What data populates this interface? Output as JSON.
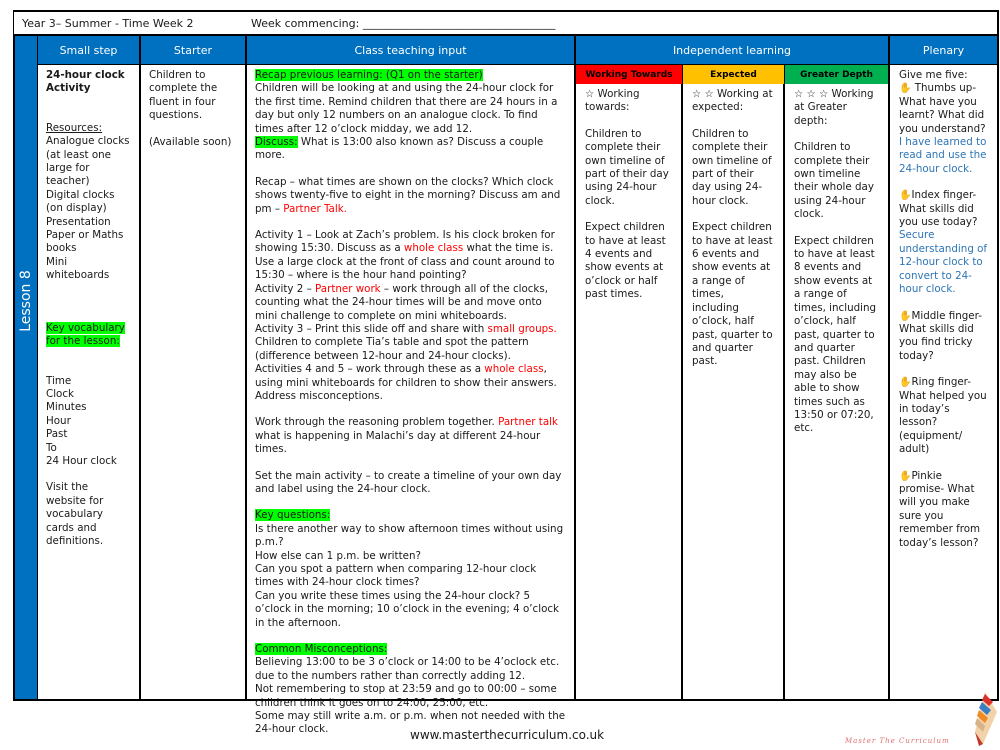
{
  "header": {
    "title": "Year 3– Summer - Time Week 2",
    "week_commencing": "Week commencing: ___________________________________"
  },
  "lesson_label": "Lesson 8",
  "columns": {
    "small_step": "Small step",
    "starter": "Starter",
    "class_teaching": "Class teaching input",
    "independent": "Independent learning",
    "plenary": "Plenary"
  },
  "levels": {
    "working_towards": {
      "label": "Working Towards",
      "color": "#ff0000"
    },
    "expected": {
      "label": "Expected",
      "color": "#ffc000"
    },
    "greater_depth": {
      "label": "Greater Depth",
      "color": "#00b050"
    }
  },
  "colors": {
    "brand_blue": "#0070c0",
    "highlight": "#00ff00",
    "emphasis_red": "#ff0000",
    "answer_blue": "#2e75b6"
  },
  "small_step": {
    "title": "24-hour clock Activity",
    "resources_heading": "Resources:",
    "resources": [
      "Analogue clocks (at least one large for teacher)",
      "Digital clocks (on display)",
      "Presentation",
      "Paper or Maths books",
      "Mini whiteboards"
    ],
    "vocab_heading": "Key vocabulary for the lesson:",
    "vocab": [
      "Time",
      "Clock",
      "Minutes",
      "Hour",
      "Past",
      "To",
      "24 Hour clock"
    ],
    "website_note": "Visit the website for vocabulary cards and definitions."
  },
  "starter": {
    "text": "Children to complete the fluent in four questions.",
    "availability": "(Available soon)"
  },
  "teaching": {
    "recap_heading": "Recap previous learning: (Q1 on the starter)",
    "recap_text": "Children will be looking at and using the 24-hour clock for the first time. Remind children that there are 24 hours in a day but only 12 numbers on an analogue clock. To find times after 12 o’clock midday, we add 12.",
    "discuss_label": "Discuss:",
    "discuss_text": " What is 13:00 also known as? Discuss a couple more.",
    "recap2_text": "Recap – what times are shown on the clocks? Which clock shows twenty-five to eight in the morning? Discuss am and pm – ",
    "recap2_red": "Partner Talk.",
    "a1_pre": "Activity 1 – Look at Zach’s problem. Is his clock broken for showing 15:30. Discuss as a ",
    "a1_red": "whole class",
    "a1_post": " what the time is. Use a large clock at the front of class and count around to 15:30 – where is the hour hand pointing?",
    "a2_pre": "Activity 2 – ",
    "a2_red": "Partner work",
    "a2_post": " – work through all of the clocks, counting what the 24-hour times will be and move onto mini challenge to complete on mini whiteboards.",
    "a3_pre": "Activity 3 – Print this slide off and share with ",
    "a3_red": "small groups.",
    "a3_post": " Children to complete Tia’s table and spot the pattern (difference between 12-hour and 24-hour clocks).",
    "a45_pre": "Activities 4 and 5 – work through these as a ",
    "a45_red": "whole class",
    "a45_post": ", using mini whiteboards for children to show their answers. Address misconceptions.",
    "reason_pre": "Work through the reasoning problem together.",
    "reason_red": " Partner talk",
    "reason_post": " what is happening in Malachi’s day at different 24-hour times.",
    "main_activity": "Set the main activity – to create a timeline of your own day and label using the 24-hour clock.",
    "key_q_heading": "Key questions:",
    "key_questions": [
      "Is there another way to show afternoon times without using p.m.?",
      "How else can 1 p.m. be written?",
      "Can you spot a pattern when comparing 12-hour clock times with 24-hour clock times?",
      "Can you write these times using the 24-hour clock? 5 o’clock in the morning; 10 o’clock in the evening; 4 o’clock in the afternoon."
    ],
    "misc_heading": "Common Misconceptions:",
    "misconceptions": [
      "Believing 13:00 to be 3 o’clock or 14:00 to be 4’oclock etc. due to the numbers rather than correctly adding 12.",
      "Not remembering to stop at 23:59 and go to 00:00 – some children think it goes on to 24:00, 25:00, etc.",
      "Some may still write a.m. or p.m. when not needed with the 24-hour clock."
    ]
  },
  "independent": {
    "working_towards": {
      "stars": "☆",
      "heading": " Working towards:",
      "task": "Children to complete their own timeline of part of their day using 24-hour clock.",
      "expectation": "Expect children to have at least 4 events and show events at o’clock or half past times."
    },
    "expected": {
      "stars": "☆ ☆",
      "heading": " Working at expected:",
      "task": "Children to complete their own timeline of part of their day using 24-hour clock.",
      "expectation": "Expect children to have at least 6 events and show events at a range of times, including o’clock, half past, quarter to and quarter past."
    },
    "greater_depth": {
      "stars": "☆ ☆ ☆",
      "heading": " Working at Greater depth:",
      "task": "Children to complete their own timeline their whole day using 24-hour clock.",
      "expectation": "Expect children to have at least 8 events and show events at a range of times, including o’clock, half past, quarter to and quarter past. Children may also be able to show times such as 13:50 or 07:20, etc."
    }
  },
  "plenary": {
    "intro": "Give me five:",
    "thumb": {
      "label": "Thumbs up- What have you learnt? What did you understand?",
      "answer": "I have learned to read and use the 24-hour clock."
    },
    "index": {
      "label": "Index finger- What skills did you use today?",
      "answer": "Secure understanding of 12-hour clock to convert to 24-hour clock."
    },
    "middle": {
      "label": "Middle finger- What skills did you find tricky today?"
    },
    "ring": {
      "label": "Ring finger- What helped you in today’s lesson? (equipment/ adult)"
    },
    "pinkie": {
      "label": "Pinkie promise- What will you make sure you remember from today’s lesson?"
    },
    "hand_icon": "✋"
  },
  "footer": {
    "url": "www.masterthecurriculum.co.uk",
    "logo_text": "Master The Curriculum"
  }
}
